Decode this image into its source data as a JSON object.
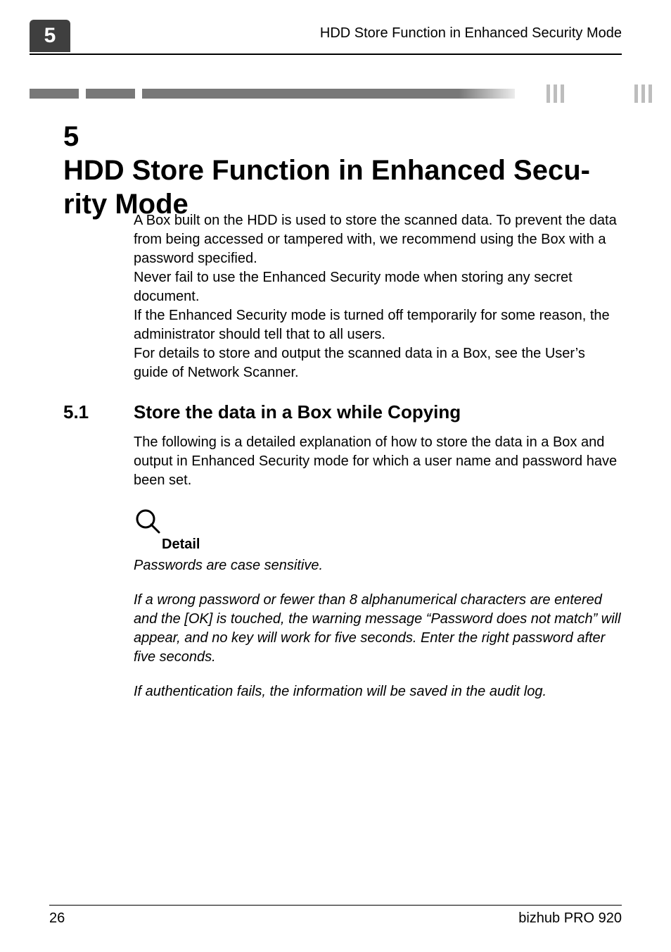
{
  "chapter_number": "5",
  "running_header": "HDD Store Function in Enhanced Security Mode",
  "heading": {
    "number": "5",
    "title_line1": "HDD Store Function in Enhanced Secu-",
    "title_line2": "rity Mode"
  },
  "intro": {
    "p1": "A Box built on the HDD is used to store the scanned data. To prevent the data from being accessed or tampered with, we recommend using the Box with a password specified.",
    "p2": "Never fail to use the Enhanced Security mode when storing any secret document.",
    "p3": "If the Enhanced Security mode is turned off temporarily for some reason, the administrator should tell that to all users.",
    "p4": "For details to store and output the scanned data in a Box, see the User’s guide of Network Scanner."
  },
  "section": {
    "number": "5.1",
    "title": "Store the data in a Box while Copying",
    "body": "The following is a detailed explanation of how to store the data in a Box and output in Enhanced Security mode for which a user name and password have been set."
  },
  "detail": {
    "label": "Detail",
    "p1": "Passwords are case sensitive.",
    "p2": "If a wrong password or fewer than 8 alphanumerical characters are entered and the [OK] is touched, the warning message “Password does not match” will appear, and no key will work for five seconds. Enter the right password after five seconds.",
    "p3": "If authentication fails, the information will be saved in the audit log."
  },
  "footer": {
    "page_number": "26",
    "product": "bizhub PRO 920"
  }
}
